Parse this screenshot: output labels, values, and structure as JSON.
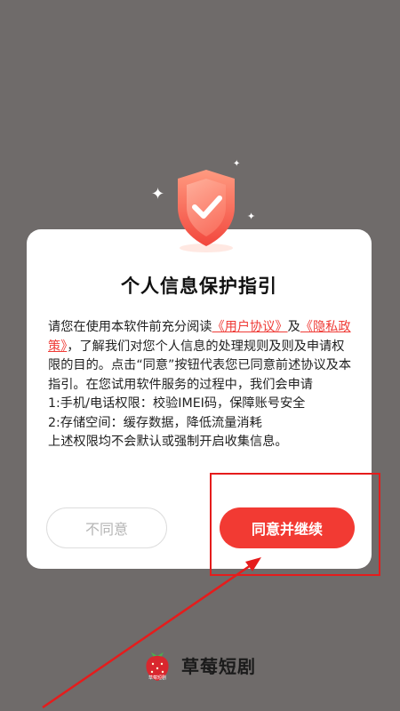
{
  "dialog": {
    "title": "个人信息保护指引",
    "lines": {
      "line1_text": "请您在使用本软件前充分阅读",
      "user_agreement_link": "《用户协议》",
      "and": "及",
      "privacy_link": "《隐私政策》",
      "line2_text": "，了解我们对您个人信息的处理规则及则及申请权限的目的。点击“同意”按钮代表您已同意前述协议及本指引。在您试用软件服务的过程中，我们会申请",
      "permission_1": "1:手机/电话权限：校验IMEI码，保障账号安全",
      "permission_2": "2:存储空间：缓存数据，降低流量消耗",
      "closing": "上述权限均不会默认或强制开启收集信息。"
    },
    "buttons": {
      "disagree": "不同意",
      "agree": "同意并继续"
    }
  },
  "brand": {
    "name": "草莓短剧",
    "logo_caption": "草莓短剧"
  },
  "icons": {
    "shield": "shield-check-icon",
    "logo": "strawberry-logo-icon"
  },
  "colors": {
    "accent": "#f23a33",
    "link": "#ef3b36",
    "annotation": "#e51c1c",
    "backdrop": "#6f6b6a"
  }
}
